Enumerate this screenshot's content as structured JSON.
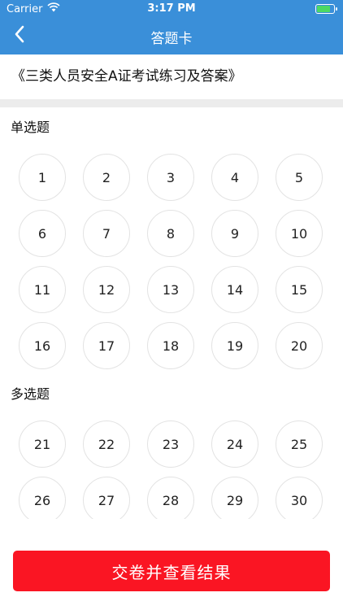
{
  "status_bar": {
    "carrier": "Carrier",
    "time": "3:17 PM",
    "battery_fraction": 0.85
  },
  "nav": {
    "title": "答题卡",
    "back_icon": "chevron-left-icon"
  },
  "exam_title": "《三类人员安全A证考试练习及答案》",
  "sections": [
    {
      "label": "单选题",
      "questions": [
        "1",
        "2",
        "3",
        "4",
        "5",
        "6",
        "7",
        "8",
        "9",
        "10",
        "11",
        "12",
        "13",
        "14",
        "15",
        "16",
        "17",
        "18",
        "19",
        "20"
      ]
    },
    {
      "label": "多选题",
      "questions": [
        "21",
        "22",
        "23",
        "24",
        "25",
        "26",
        "27",
        "28",
        "29",
        "30"
      ]
    }
  ],
  "submit_label": "交卷并查看结果",
  "colors": {
    "header": "#3a8fd9",
    "submit": "#fa1523",
    "divider": "#ececec"
  }
}
